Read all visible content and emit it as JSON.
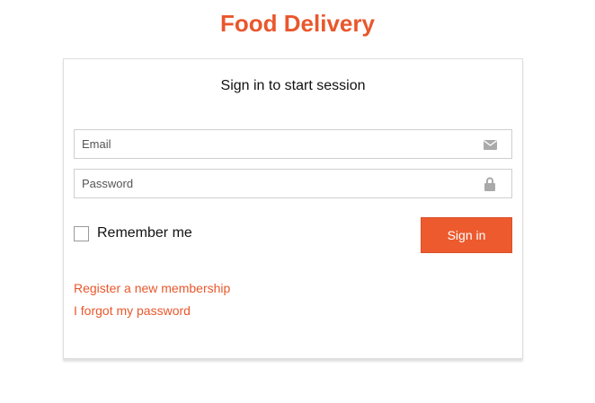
{
  "app": {
    "title": "Food Delivery",
    "accent_color": "#e9572c"
  },
  "login": {
    "heading": "Sign in to start session",
    "email": {
      "placeholder": "Email",
      "value": "",
      "icon": "envelope-icon"
    },
    "password": {
      "placeholder": "Password",
      "value": "",
      "icon": "lock-icon"
    },
    "remember_label": "Remember me",
    "remember_checked": false,
    "signin_label": "Sign in",
    "register_link": "Register a new membership",
    "forgot_link": "I forgot my password"
  }
}
